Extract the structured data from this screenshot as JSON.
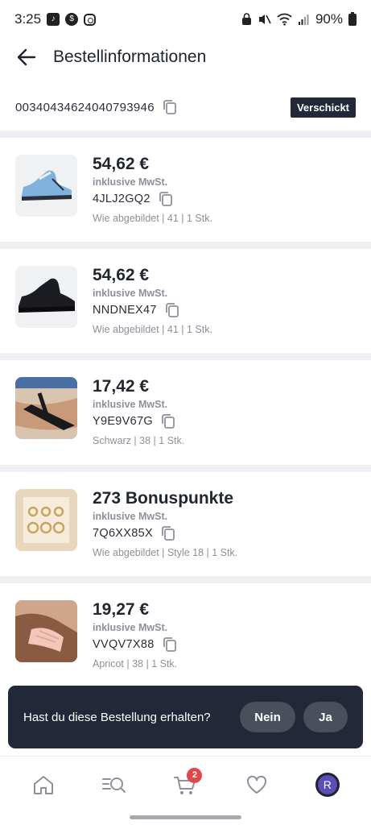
{
  "status_bar": {
    "time": "3:25",
    "battery": "90%"
  },
  "header": {
    "title": "Bestellinformationen"
  },
  "order": {
    "number": "00340434624040793946",
    "status": "Verschickt"
  },
  "items": [
    {
      "price": "54,62 €",
      "tax_note": "inklusive MwSt.",
      "sku": "4JLJ2GQ2",
      "attributes": "Wie abgebildet | 41 | 1 Stk."
    },
    {
      "price": "54,62 €",
      "tax_note": "inklusive MwSt.",
      "sku": "NNDNEX47",
      "attributes": "Wie abgebildet | 41 | 1 Stk."
    },
    {
      "price": "17,42 €",
      "tax_note": "inklusive MwSt.",
      "sku": "Y9E9V67G",
      "attributes": "Schwarz | 38 | 1 Stk."
    },
    {
      "price": "273 Bonuspunkte",
      "tax_note": "inklusive MwSt.",
      "sku": "7Q6XX85X",
      "attributes": "Wie abgebildet | Style 18 | 1 Stk."
    },
    {
      "price": "19,27 €",
      "tax_note": "inklusive MwSt.",
      "sku": "VVQV7X88",
      "attributes": "Apricot | 38 | 1 Stk."
    }
  ],
  "toast": {
    "question": "Hast du diese Bestellung erhalten?",
    "no_label": "Nein",
    "yes_label": "Ja"
  },
  "nav": {
    "cart_count": "2",
    "avatar_initial": "R"
  },
  "icons": [
    "back-arrow-icon",
    "copy-icon",
    "home-icon",
    "search-icon",
    "cart-icon",
    "heart-icon"
  ],
  "colors": {
    "badge_bg": "#232838",
    "toast_bg": "#232838",
    "cart_badge": "#e3474c",
    "avatar": "#5b4fb7"
  }
}
